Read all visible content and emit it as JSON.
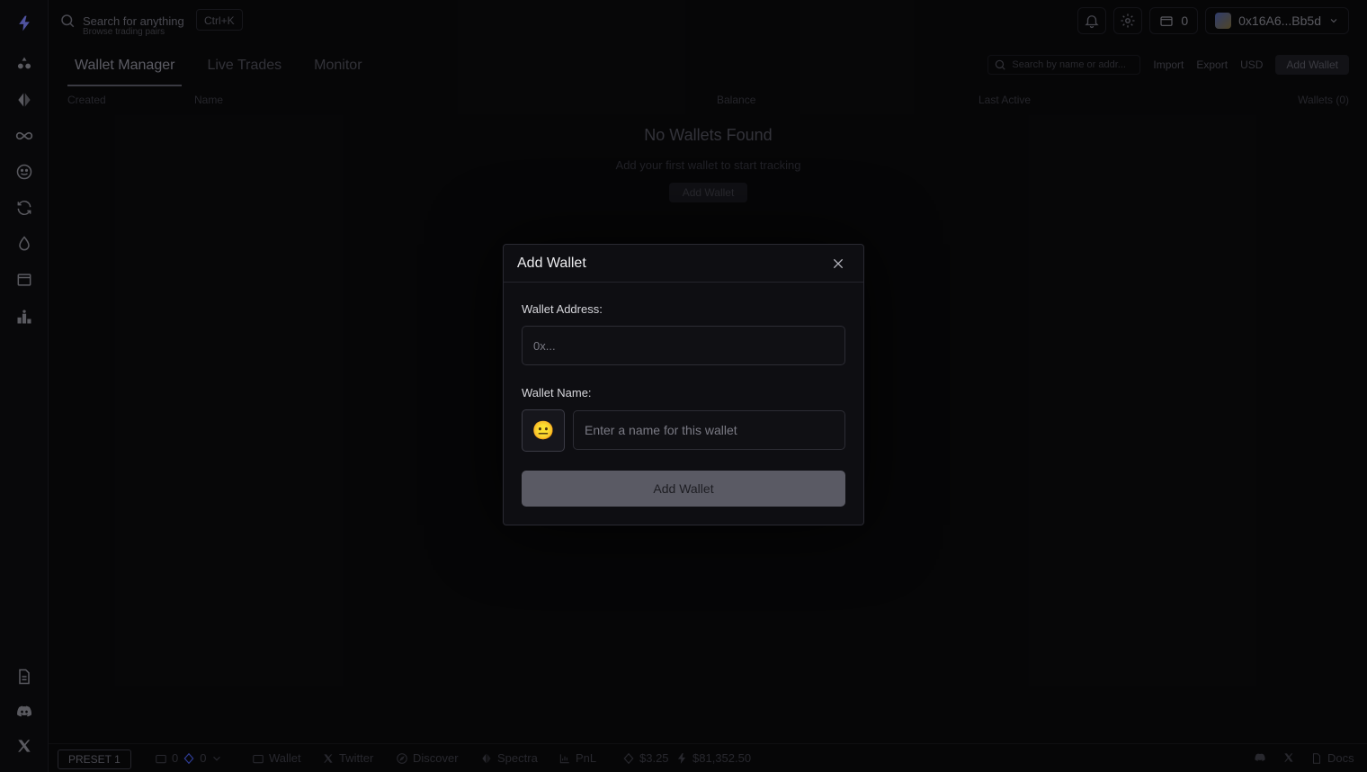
{
  "topbar": {
    "search_title": "Search for anything",
    "search_sub": "Browse trading pairs",
    "shortcut": "Ctrl+K",
    "count": "0",
    "account": "0x16A6...Bb5d"
  },
  "tabs": [
    "Wallet Manager",
    "Live Trades",
    "Monitor"
  ],
  "actions": {
    "search_placeholder": "Search by name or addr...",
    "import": "Import",
    "export": "Export",
    "currency": "USD",
    "add_wallet": "Add Wallet"
  },
  "table_header": {
    "created": "Created",
    "name": "Name",
    "balance": "Balance",
    "last_active": "Last Active",
    "wallets": "Wallets (0)"
  },
  "empty": {
    "title": "No Wallets Found",
    "subtitle": "Add your first wallet to start tracking",
    "button": "Add Wallet"
  },
  "modal": {
    "title": "Add Wallet",
    "address_label": "Wallet Address:",
    "address_placeholder": "0x...",
    "name_label": "Wallet Name:",
    "emoji": "😐",
    "name_placeholder": "Enter a name for this wallet",
    "submit": "Add Wallet"
  },
  "footer": {
    "preset": "PRESET 1",
    "count_a": "0",
    "count_b": "0",
    "wallet": "Wallet",
    "twitter": "Twitter",
    "discover": "Discover",
    "spectra": "Spectra",
    "pnl": "PnL",
    "price_a": "$3.25",
    "price_b": "$81,352.50",
    "docs": "Docs"
  },
  "colors": {
    "background": "#0a0a0c",
    "modal_bg": "#0e0e12",
    "accent_logo": "#7a7ff5",
    "submit_bg": "#5a5a64"
  }
}
